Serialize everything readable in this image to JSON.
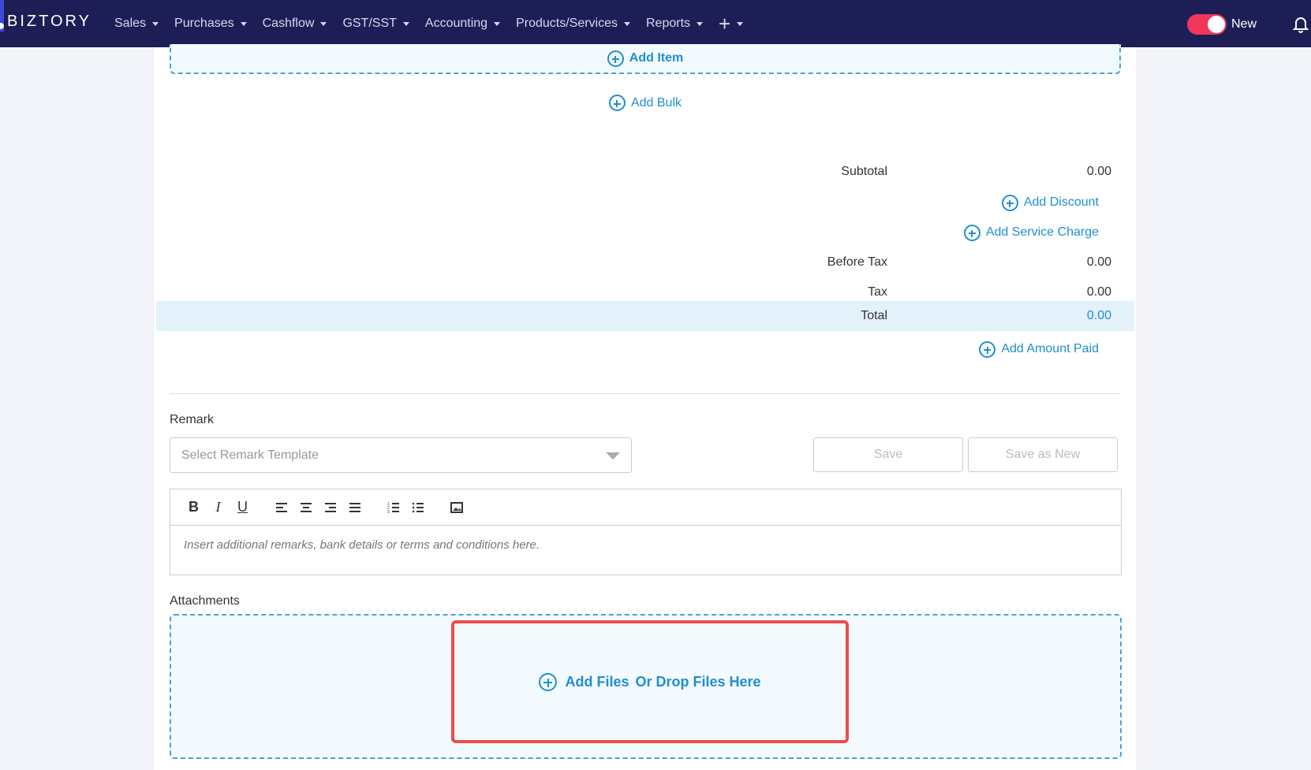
{
  "navbar": {
    "brand": "BIZTORY",
    "menu": [
      {
        "label": "Sales"
      },
      {
        "label": "Purchases"
      },
      {
        "label": "Cashflow"
      },
      {
        "label": "GST/SST"
      },
      {
        "label": "Accounting"
      },
      {
        "label": "Products/Services"
      },
      {
        "label": "Reports"
      }
    ],
    "plus_icon": "plus-icon",
    "toggle_label": "New",
    "toggle_on": true,
    "bell_icon": "bell-icon",
    "colors": {
      "bar": "#1e1e57",
      "toggle": "#f0375a"
    }
  },
  "items": {
    "add_item_label": "Add Item",
    "add_bulk_label": "Add Bulk"
  },
  "totals": {
    "subtotal_label": "Subtotal",
    "subtotal_value": "0.00",
    "add_discount_label": "Add Discount",
    "add_service_charge_label": "Add Service Charge",
    "before_tax_label": "Before Tax",
    "before_tax_value": "0.00",
    "tax_label": "Tax",
    "tax_value": "0.00",
    "total_label": "Total",
    "total_value": "0.00",
    "add_amount_paid_label": "Add Amount Paid"
  },
  "remark": {
    "label": "Remark",
    "template_placeholder": "Select Remark Template",
    "save_label": "Save",
    "save_as_new_label": "Save as New",
    "editor_placeholder": "Insert additional remarks, bank details or terms and conditions here.",
    "toolbar": [
      "bold",
      "italic",
      "underline",
      "align-left",
      "align-center",
      "align-right",
      "align-justify",
      "ordered-list",
      "unordered-list",
      "image"
    ]
  },
  "attachments": {
    "label": "Attachments",
    "add_files_label": "Add Files",
    "drop_label": "Or Drop Files Here"
  },
  "accent_color": "#1f8fd0",
  "highlight_color": "#ee4b4b"
}
